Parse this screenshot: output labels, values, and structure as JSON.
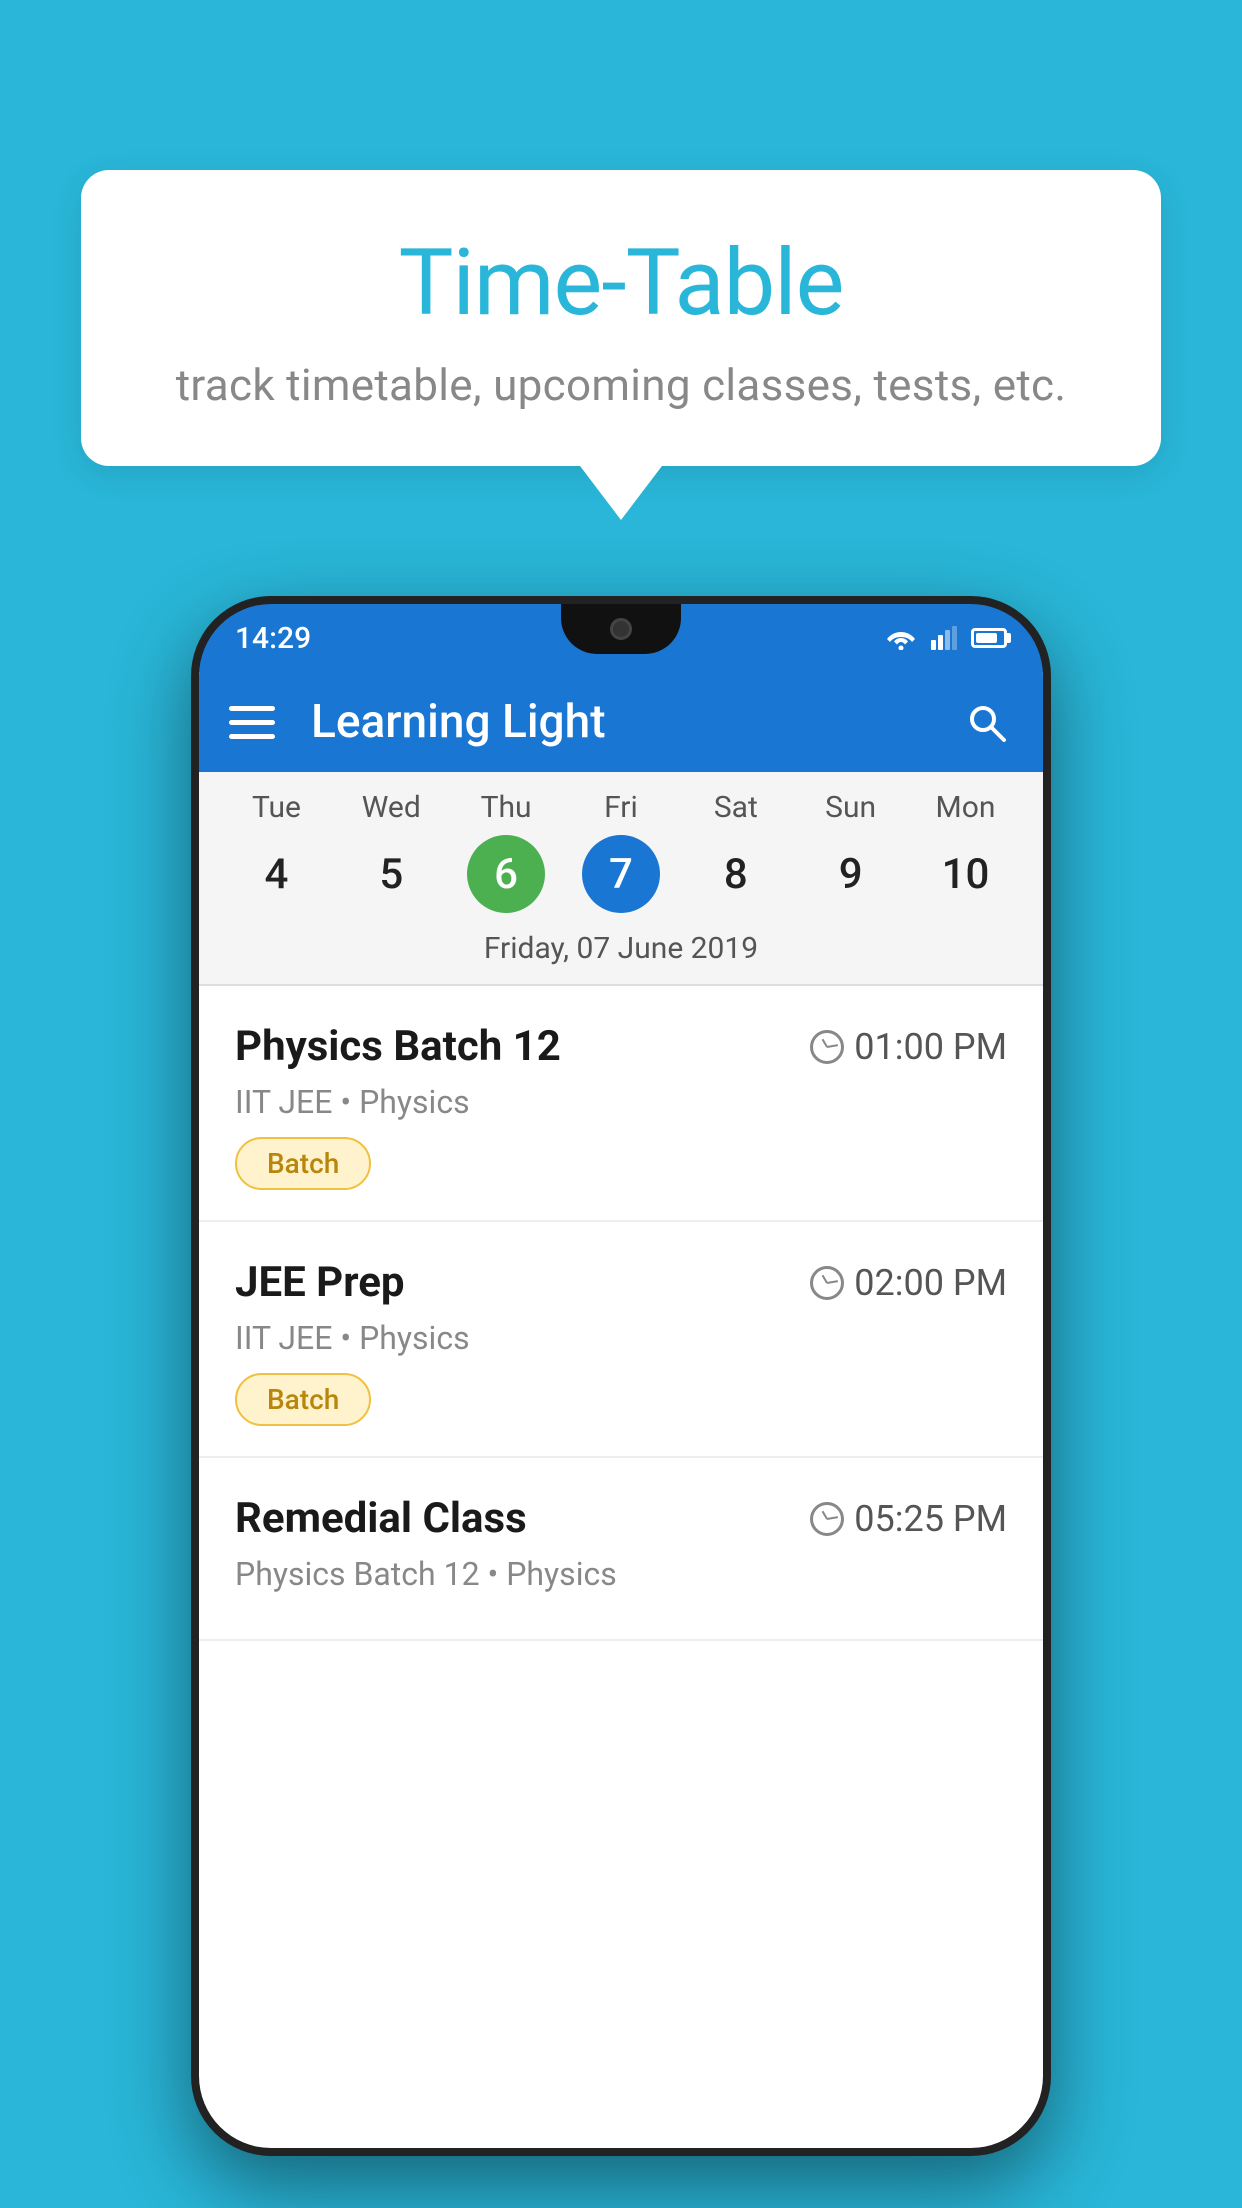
{
  "background_color": "#29b6d8",
  "speech_bubble": {
    "title": "Time-Table",
    "subtitle": "track timetable, upcoming classes, tests, etc."
  },
  "phone": {
    "status_bar": {
      "time": "14:29"
    },
    "app_bar": {
      "title": "Learning Light"
    },
    "calendar": {
      "days": [
        {
          "name": "Tue",
          "number": "4",
          "state": "normal"
        },
        {
          "name": "Wed",
          "number": "5",
          "state": "normal"
        },
        {
          "name": "Thu",
          "number": "6",
          "state": "today"
        },
        {
          "name": "Fri",
          "number": "7",
          "state": "selected"
        },
        {
          "name": "Sat",
          "number": "8",
          "state": "normal"
        },
        {
          "name": "Sun",
          "number": "9",
          "state": "normal"
        },
        {
          "name": "Mon",
          "number": "10",
          "state": "normal"
        }
      ],
      "selected_date_label": "Friday, 07 June 2019"
    },
    "schedule_items": [
      {
        "title": "Physics Batch 12",
        "time": "01:00 PM",
        "subtitle": "IIT JEE • Physics",
        "badge": "Batch"
      },
      {
        "title": "JEE Prep",
        "time": "02:00 PM",
        "subtitle": "IIT JEE • Physics",
        "badge": "Batch"
      },
      {
        "title": "Remedial Class",
        "time": "05:25 PM",
        "subtitle": "Physics Batch 12 • Physics",
        "badge": null
      }
    ]
  }
}
